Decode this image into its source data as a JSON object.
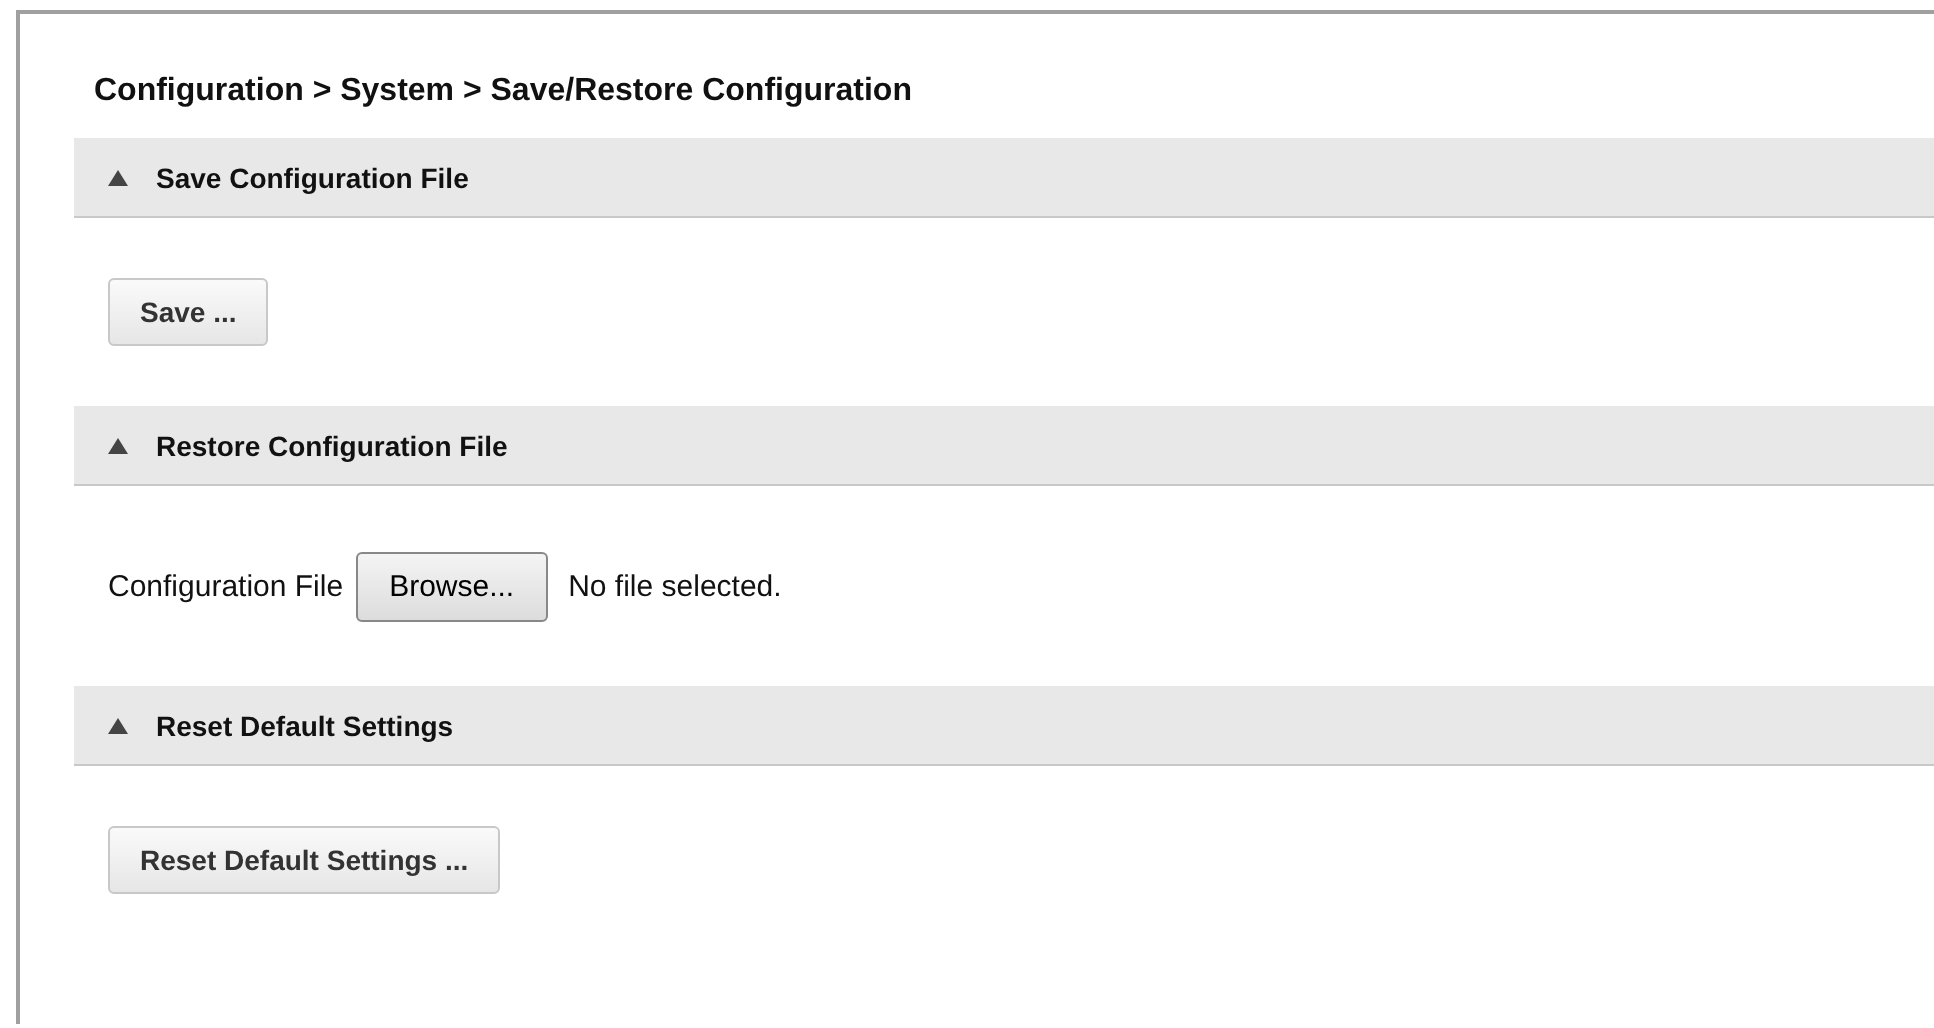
{
  "title": "Configuration > System > Save/Restore Configuration",
  "sections": [
    {
      "title": "Save Configuration File",
      "expanded": true,
      "kind": "button",
      "button": "Save ..."
    },
    {
      "title": "Restore Configuration File",
      "expanded": true,
      "kind": "file",
      "label": "Configuration File",
      "button": "Browse...",
      "status": "No file selected."
    },
    {
      "title": "Reset Default Settings",
      "expanded": true,
      "kind": "button",
      "button": "Reset Default Settings ..."
    }
  ]
}
